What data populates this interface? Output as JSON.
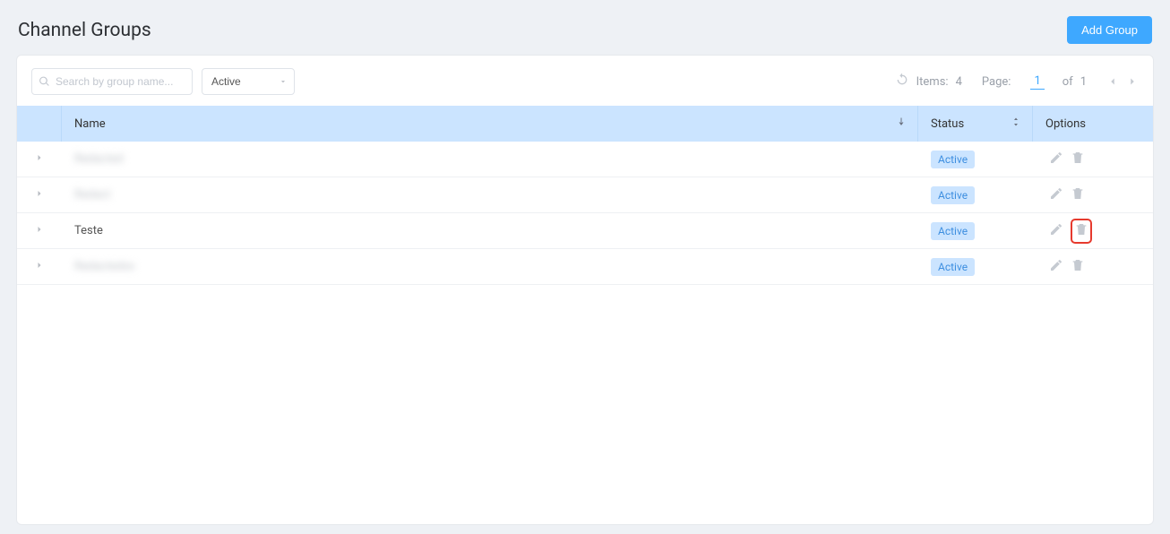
{
  "header": {
    "title": "Channel Groups",
    "add_button": "Add Group"
  },
  "toolbar": {
    "search_placeholder": "Search by group name...",
    "filter_value": "Active",
    "items_label": "Items:",
    "items_count": "4",
    "page_label": "Page:",
    "current_page": "1",
    "of_label": "of",
    "total_pages": "1"
  },
  "columns": {
    "name": "Name",
    "status": "Status",
    "options": "Options"
  },
  "rows": [
    {
      "name": "Redacted",
      "status": "Active",
      "blurred": true,
      "highlight_delete": false
    },
    {
      "name": "Redact",
      "status": "Active",
      "blurred": true,
      "highlight_delete": false
    },
    {
      "name": "Teste",
      "status": "Active",
      "blurred": false,
      "highlight_delete": true
    },
    {
      "name": "Redactedxx",
      "status": "Active",
      "blurred": true,
      "highlight_delete": false
    }
  ]
}
